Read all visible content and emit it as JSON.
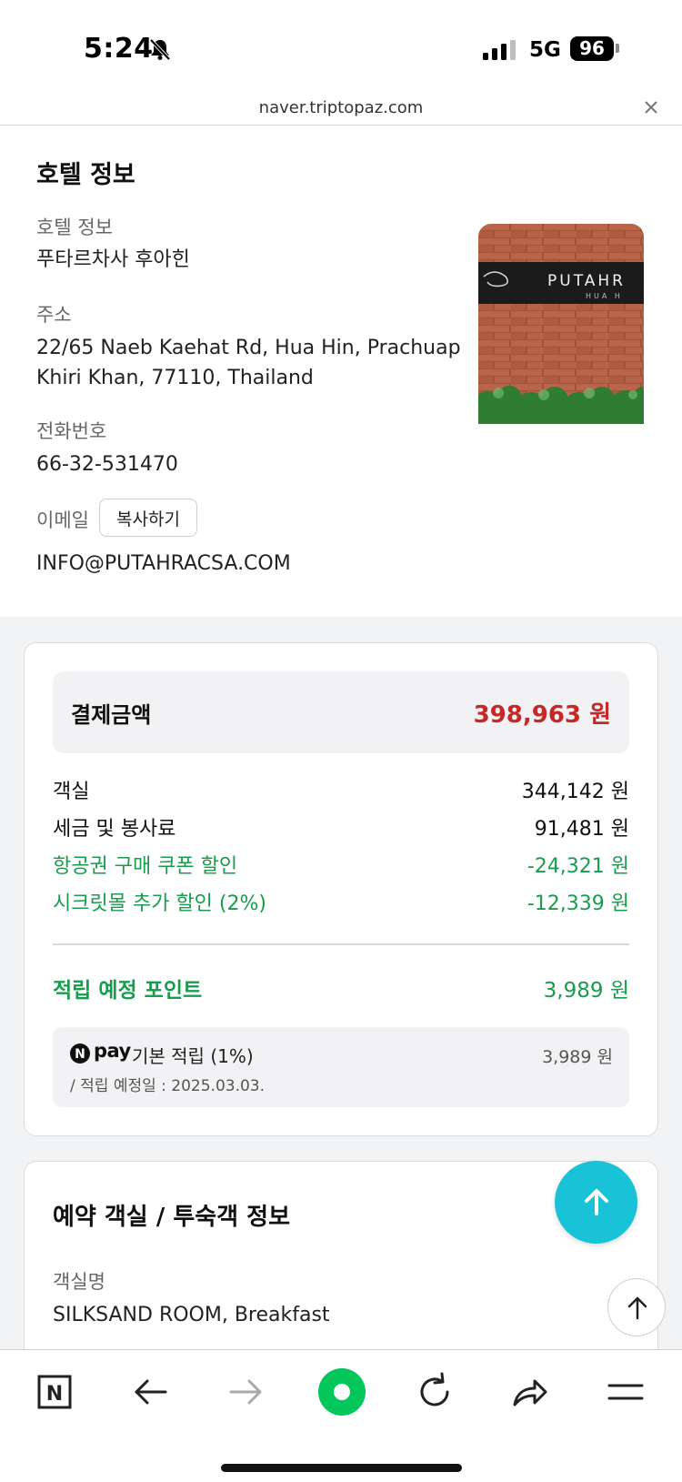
{
  "status_bar": {
    "time": "5:24",
    "network": "5G",
    "battery": "96"
  },
  "browser": {
    "url": "naver.triptopaz.com"
  },
  "hotel": {
    "section_title": "호텔 정보",
    "name_label": "호텔 정보",
    "name": "푸타르차사 후아힌",
    "address_label": "주소",
    "address_line1": "22/65 Naeb Kaehat Rd, Hua Hin, Prachuap",
    "address_line2": "Khiri Khan, 77110, Thailand",
    "phone_label": "전화번호",
    "phone": "66-32-531470",
    "email_label": "이메일",
    "copy_button": "복사하기",
    "email": "INFO@PUTAHRACSA.COM",
    "image_sign_text": "PUTAHR",
    "image_sign_sub": "HUA H"
  },
  "payment": {
    "total_label": "결제금액",
    "total_value": "398,963 원",
    "rows": [
      {
        "label": "객실",
        "value": "344,142 원"
      },
      {
        "label": "세금 및 봉사료",
        "value": "91,481 원"
      },
      {
        "label": "항공권 구매 쿠폰 할인",
        "value": "-24,321 원"
      },
      {
        "label": "시크릿몰 추가 할인 (2%)",
        "value": "-12,339 원"
      }
    ],
    "points_label": "적립 예정 포인트",
    "points_value": "3,989 원",
    "npay": {
      "logo_letter": "N",
      "brand": "pay",
      "title": "기본 적립 (1%)",
      "amount": "3,989 원",
      "date_note": "/ 적립 예정일 : 2025.03.03."
    }
  },
  "room": {
    "section_title": "예약 객실 / 투숙객 정보",
    "name_label": "객실명",
    "name": "SILKSAND ROOM, Breakfast"
  },
  "nav": {
    "n_logo": "N"
  },
  "colors": {
    "accent_green": "#1a9c4e",
    "total_red": "#c62828",
    "fab_cyan": "#19c2d6",
    "naver_green": "#03c75a"
  }
}
